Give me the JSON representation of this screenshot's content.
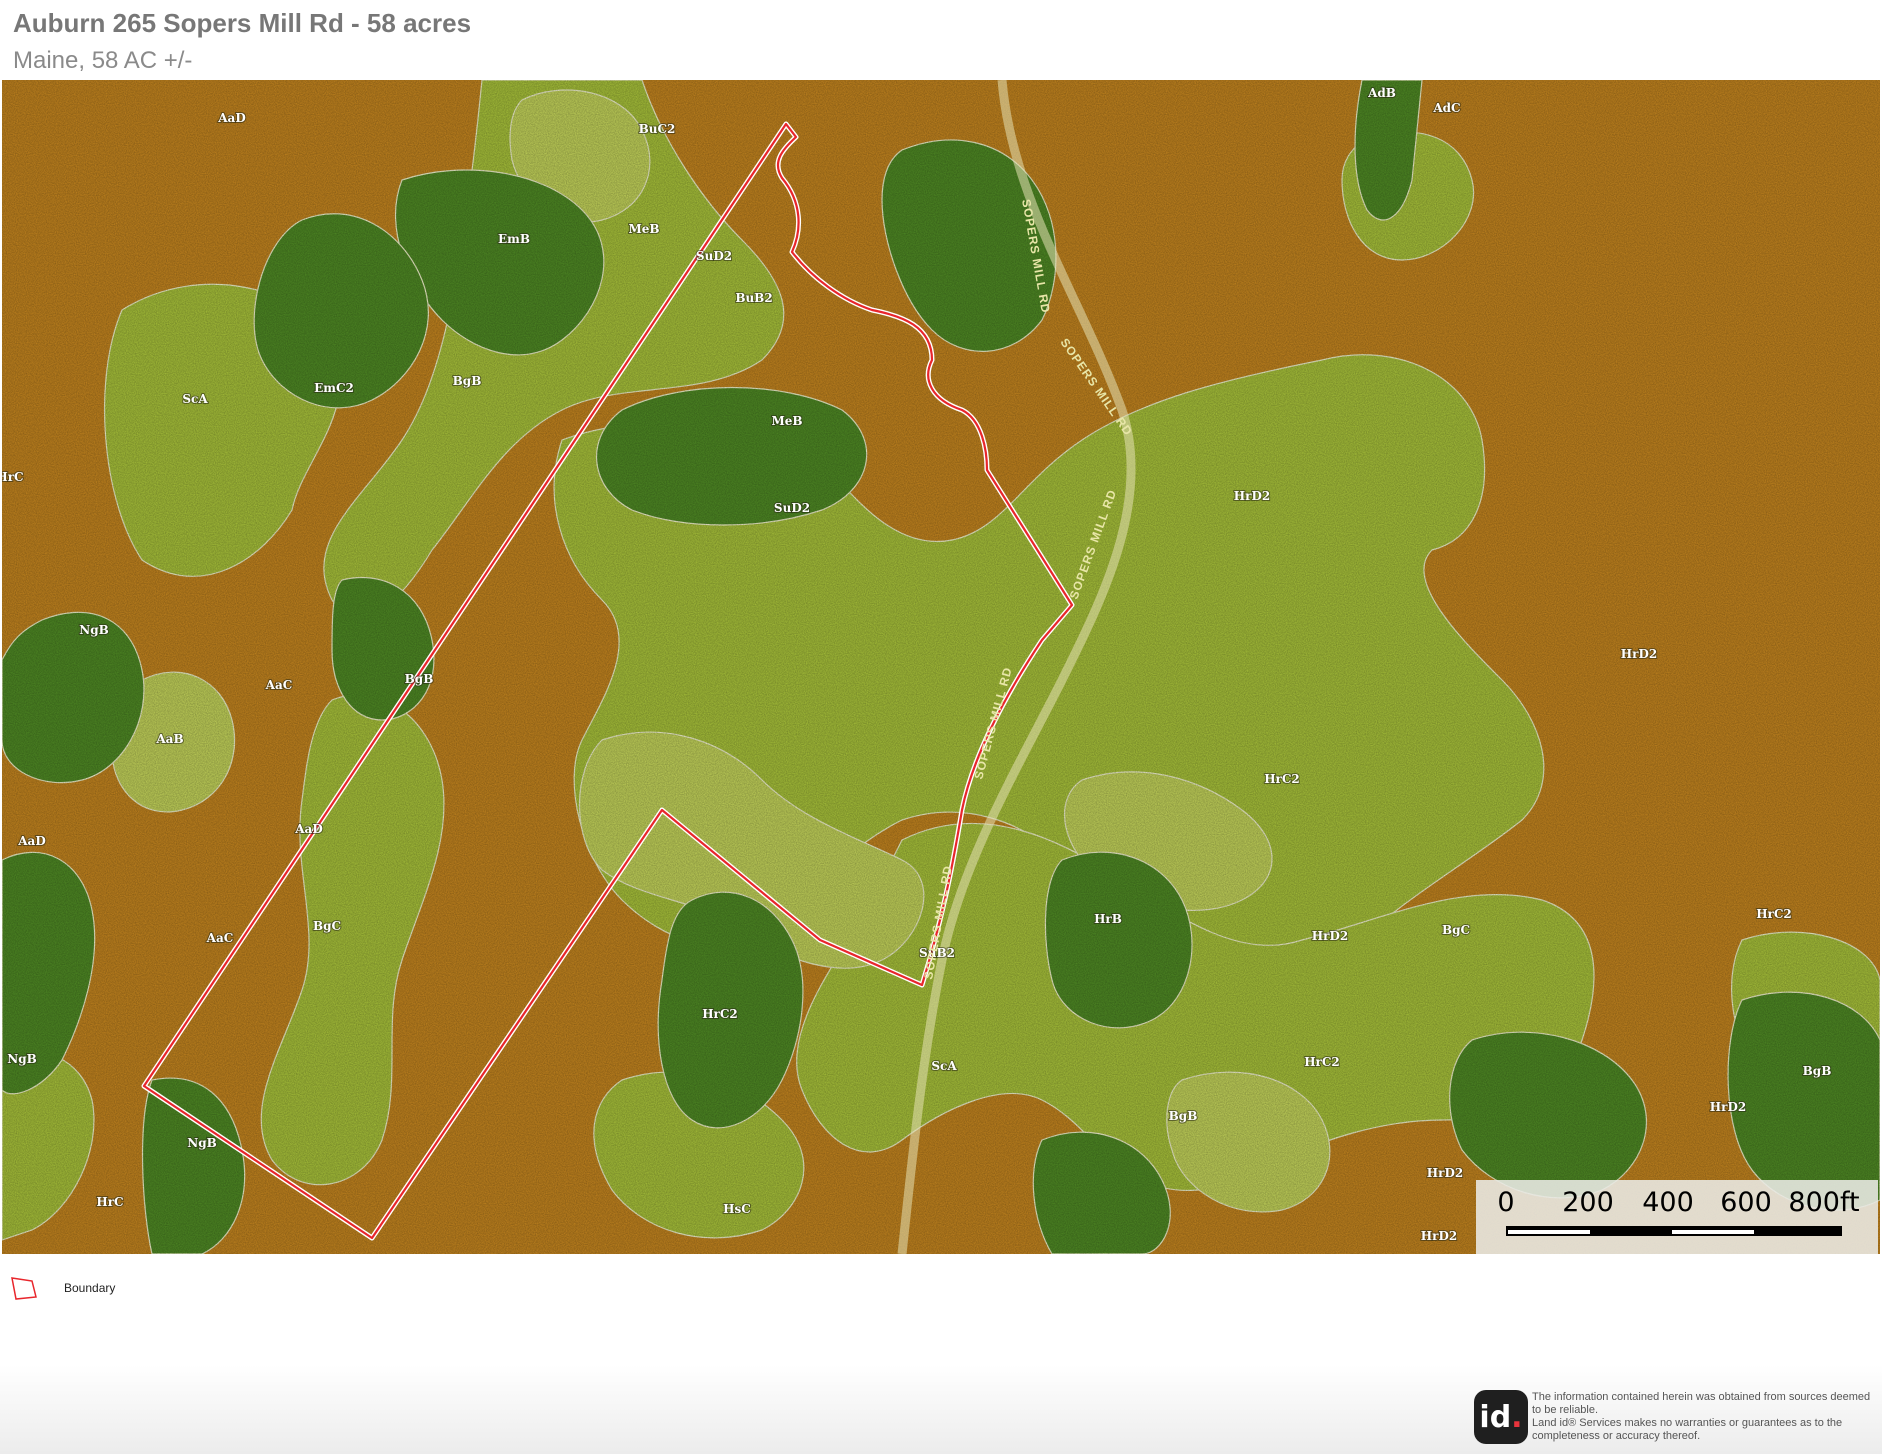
{
  "header": {
    "title": "Auburn 265 Sopers Mill Rd  - 58 acres",
    "subtitle": "Maine, 58 AC +/-"
  },
  "map": {
    "soil_units": [
      "AaD",
      "BuC2",
      "AdB",
      "AdC",
      "EmB",
      "MeB",
      "SuD2",
      "BuB2",
      "EmC2",
      "BgB",
      "ScA",
      "MeB",
      "SuD2",
      "HrC",
      "HrD2",
      "NgB",
      "AaC",
      "AaB",
      "HrD2",
      "AaD",
      "AaD",
      "BgC",
      "AaC",
      "HrC2",
      "HrD2",
      "HrB",
      "BgC",
      "HrC2",
      "NgB",
      "HrC2",
      "SuB2",
      "ScA",
      "HrD2",
      "HrC2",
      "BgB",
      "BgB",
      "HrD2",
      "BgB",
      "NgB",
      "HrC",
      "HsC",
      "HrD2"
    ],
    "road_name": "SOPERS MILL RD",
    "colors": {
      "moderate_orange": "#c9891f",
      "light_green": "#a9c43a",
      "pale_green": "#c2d45a",
      "dark_green": "#4d8a22",
      "boundary": "#e8262c"
    }
  },
  "scalebar": {
    "ticks": [
      "0",
      "200",
      "400",
      "600",
      "800ft"
    ]
  },
  "legend": {
    "items": [
      {
        "label": "Boundary",
        "icon": "boundary-polygon-icon",
        "color": "#e8262c"
      }
    ]
  },
  "footer": {
    "logo": "id",
    "logo_dot": ".",
    "disclaimer_1": "The information contained herein was obtained from sources deemed to be reliable.",
    "disclaimer_2": "Land id® Services makes no warranties or guarantees as to the completeness or accuracy thereof."
  }
}
